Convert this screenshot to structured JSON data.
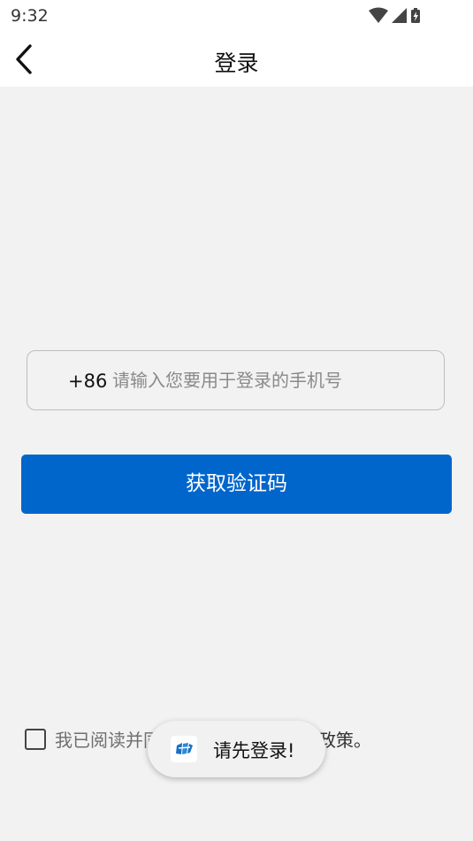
{
  "status_bar": {
    "time": "9:32",
    "icons": [
      "wifi-icon",
      "signal-icon",
      "battery-icon"
    ]
  },
  "header": {
    "title": "登录",
    "back_icon": "chevron-left-icon"
  },
  "login_form": {
    "country_code": "+86",
    "phone_placeholder": "请输入您要用于登录的手机号",
    "phone_value": "",
    "get_code_label": "获取验证码"
  },
  "agreement": {
    "checked": false,
    "text_visible_start": "我已阅读并同",
    "text_visible_end": "政策。"
  },
  "toast": {
    "message": "请先登录!",
    "icon": "app-logo-icon"
  },
  "colors": {
    "primary": "#0066cc",
    "background": "#f2f2f2",
    "header_bg": "#ffffff"
  }
}
